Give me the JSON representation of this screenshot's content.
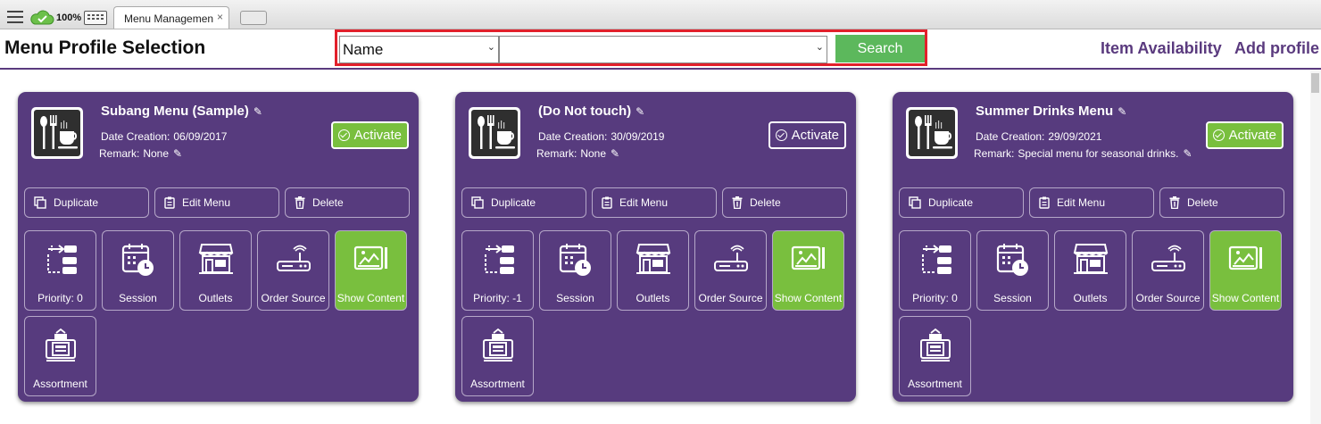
{
  "browser": {
    "zoom": "100%",
    "tab_title": "Menu Managemen",
    "tab_close": "×"
  },
  "header": {
    "title": "Menu Profile Selection",
    "search": {
      "field_selected": "Name",
      "value_selected": "",
      "button_label": "Search"
    },
    "links": [
      "Item Availability",
      "Add profile"
    ]
  },
  "labels": {
    "date_creation": "Date Creation:",
    "remark": "Remark:",
    "activate": "Activate",
    "duplicate": "Duplicate",
    "edit_menu": "Edit Menu",
    "delete": "Delete",
    "priority": "Priority:",
    "session": "Session",
    "outlets": "Outlets",
    "order_source": "Order Source",
    "show_content": "Show Content",
    "assortment": "Assortment"
  },
  "cards": [
    {
      "title": "Subang Menu (Sample)",
      "date": "06/09/2017",
      "remark": "None",
      "priority": "0",
      "active": true
    },
    {
      "title": "(Do Not touch)",
      "date": "30/09/2019",
      "remark": "None",
      "priority": "-1",
      "active": false
    },
    {
      "title": "Summer Drinks Menu",
      "date": "29/09/2021",
      "remark": "Special menu for seasonal drinks.",
      "priority": "0",
      "active": true
    }
  ],
  "colors": {
    "card_purple": "#573b7e",
    "accent_green": "#79bf3e",
    "search_green": "#5cb85c",
    "highlight_red": "#e2202b"
  }
}
